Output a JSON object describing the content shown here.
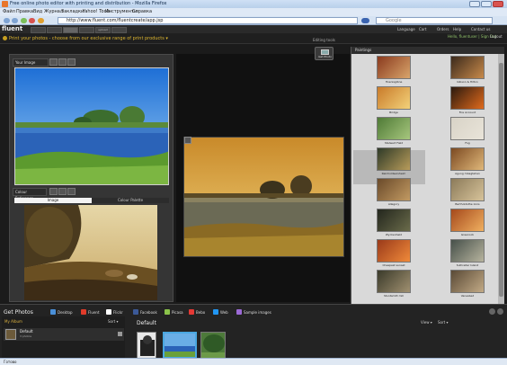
{
  "browser": {
    "title": "Free online photo editor with printing and distribution - Mozilla Firefox",
    "menu": [
      "Файл",
      "Правка",
      "Вид",
      "Журнал",
      "Закладки",
      "Yahoo! Tools",
      "Инструменты",
      "Справка"
    ],
    "url": "http://www.fluent.com/fluentcreate/app.jsp",
    "search_placeholder": "Google",
    "status": "Готово"
  },
  "site": {
    "logo": "fluent",
    "logo_mark": "",
    "tabs": [
      "",
      "",
      "",
      "",
      "upload",
      "",
      "",
      ""
    ],
    "header_links": [
      "Language",
      "Cart",
      "Orders",
      "Help",
      "Contact us"
    ],
    "user": "Hello, fluentuser | Sign Out",
    "logout": "Logout"
  },
  "promo": {
    "text": "Print your photos - choose from our exclusive range of print products ▾",
    "editing_tools": "Editing tools"
  },
  "left_panel": {
    "your_image": "Your Image",
    "colour_reference": "Colour Reference",
    "subtabs": [
      "Image",
      "Colour Palette"
    ]
  },
  "center_panel": {
    "get_photo": "Get Photo"
  },
  "right_panel": {
    "title": "Paintings",
    "items": [
      {
        "label": "Hoenisgibne",
        "color_a": "#8a3a1e",
        "color_b": "#d9a56b"
      },
      {
        "label": "Gibson & Hilton",
        "color_a": "#3b2a1c",
        "color_b": "#c88a4a"
      },
      {
        "label": "Bridge",
        "color_a": "#c97b2a",
        "color_b": "#f3d27a"
      },
      {
        "label": "Fire Account",
        "color_a": "#2b1a0f",
        "color_b": "#e06a1c"
      },
      {
        "label": "Stalwart Field",
        "color_a": "#4f7a36",
        "color_b": "#a7c77e"
      },
      {
        "label": "Fog",
        "color_a": "#d8d3c7",
        "color_b": "#e9e4d9"
      },
      {
        "label": "Reinholdsersheim",
        "color_a": "#2e3a28",
        "color_b": "#b89c5a"
      },
      {
        "label": "Agung mbagtehan",
        "color_a": "#7c4a22",
        "color_b": "#e0b87a"
      },
      {
        "label": "Allegory",
        "color_a": "#6a4a2a",
        "color_b": "#c29a62"
      },
      {
        "label": "Bartholdsthe Ionis",
        "color_a": "#8c7b5a",
        "color_b": "#d7c39a"
      },
      {
        "label": "Wyckenheld",
        "color_a": "#23261d",
        "color_b": "#6a6b4a"
      },
      {
        "label": "Greenock",
        "color_a": "#a5491c",
        "color_b": "#f0b060"
      },
      {
        "label": "Cheapest sunset",
        "color_a": "#9a3a1a",
        "color_b": "#f08a3a"
      },
      {
        "label": "Sulhreiter Island",
        "color_a": "#46504a",
        "color_b": "#b7b49e"
      },
      {
        "label": "Stuntsmitt mill",
        "color_a": "#3a3a2a",
        "color_b": "#a09070"
      },
      {
        "label": "Vanesbed",
        "color_a": "#5a4a36",
        "color_b": "#c2aa86"
      }
    ]
  },
  "bottom": {
    "title": "Get Photos",
    "sources": [
      {
        "label": "Desktop",
        "color": "#4a90d9"
      },
      {
        "label": "Fluent",
        "color": "#e03b2a"
      },
      {
        "label": "Flickr",
        "color": "#ffffff"
      },
      {
        "label": "Facebook",
        "color": "#3b5998"
      },
      {
        "label": "Picasa",
        "color": "#8bc34a"
      },
      {
        "label": "Bebo",
        "color": "#e53935"
      },
      {
        "label": "Web",
        "color": "#2196f3"
      },
      {
        "label": "Sample images",
        "color": "#9c6ad6"
      }
    ],
    "my_album": "My Album",
    "sort": "Sort ▾",
    "album_name": "Default",
    "album_count": "3 photos",
    "default_heading": "Default",
    "view": "View ▾",
    "sort2": "Sort ▾"
  }
}
